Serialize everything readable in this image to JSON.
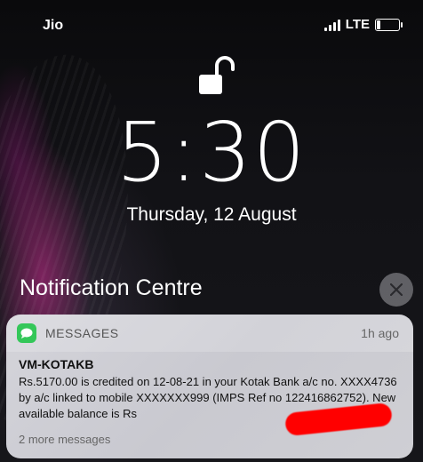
{
  "status_bar": {
    "carrier": "Jio",
    "network_type": "LTE",
    "signal_bars": 4,
    "battery_level": 0.15
  },
  "lock_screen": {
    "lock_icon": "unlocked-padlock-icon",
    "time": "5:30",
    "date": "Thursday, 12 August"
  },
  "notification_centre": {
    "title": "Notification Centre",
    "close_icon": "close-icon"
  },
  "notification": {
    "app_icon": "messages-icon",
    "app_name": "MESSAGES",
    "time": "1h ago",
    "sender": "VM-KOTAKB",
    "body": "Rs.5170.00 is credited on 12-08-21 in your Kotak Bank a/c no. XXXX4736 by a/c linked to mobile XXXXXXX999 (IMPS Ref no 122416862752). New available balance is Rs",
    "more_messages": "2 more messages"
  },
  "colors": {
    "messages_green": "#34c759",
    "redaction_red": "#ff0000",
    "card_background": "#cfcfd4"
  }
}
